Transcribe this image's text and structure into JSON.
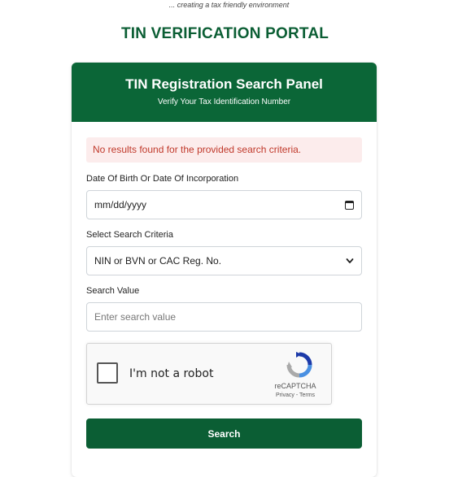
{
  "header": {
    "tagline": "... creating a tax friendly environment",
    "portal_title": "TIN VERIFICATION PORTAL"
  },
  "panel": {
    "title": "TIN Registration Search Panel",
    "subtitle": "Verify Your Tax Identification Number"
  },
  "alert": {
    "message": "No results found for the provided search criteria."
  },
  "form": {
    "dob_label": "Date Of Birth Or Date Of Incorporation",
    "dob_value": "mm/dd/yyyy",
    "criteria_label": "Select Search Criteria",
    "criteria_value": "NIN or BVN or CAC Reg. No.",
    "search_value_label": "Search Value",
    "search_value_placeholder": "Enter search value"
  },
  "recaptcha": {
    "label": "I'm not a robot",
    "brand": "reCAPTCHA",
    "links": "Privacy - Terms"
  },
  "actions": {
    "search_label": "Search"
  },
  "colors": {
    "brand_green": "#0b6637",
    "alert_bg": "#fcecec",
    "alert_text": "#c0392b"
  }
}
